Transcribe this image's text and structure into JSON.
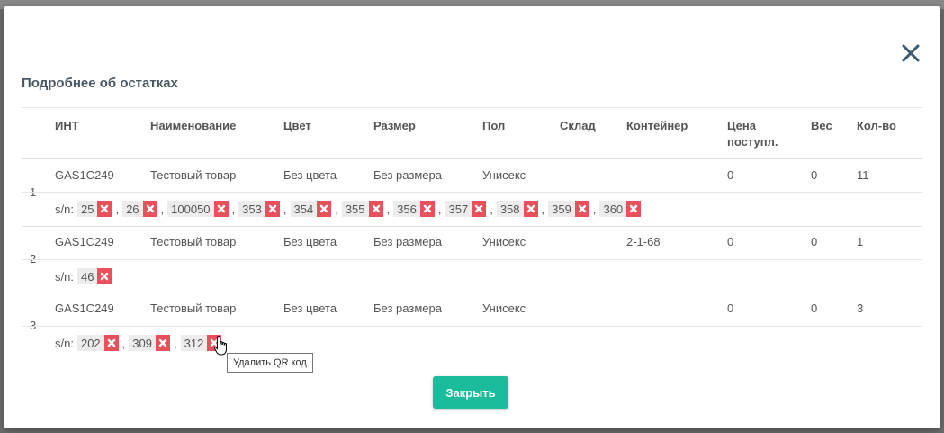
{
  "modal": {
    "title": "Подробнее об остатках",
    "close_button": "Закрыть"
  },
  "columns": {
    "int": "ИНТ",
    "name": "Наименование",
    "color": "Цвет",
    "size": "Размер",
    "gender": "Пол",
    "warehouse": "Склад",
    "container": "Контейнер",
    "price": "Цена поступл.",
    "weight": "Вес",
    "qty": "Кол-во"
  },
  "serial_label": "s/n:",
  "rows": [
    {
      "num": "1",
      "int": "GAS1C249",
      "name": "Тестовый товар",
      "color": "Без цвета",
      "size": "Без размера",
      "gender": "Унисекс",
      "warehouse": "",
      "container": "",
      "price": "0",
      "weight": "0",
      "qty": "11",
      "serials": [
        "25",
        "26",
        "100050",
        "353",
        "354",
        "355",
        "356",
        "357",
        "358",
        "359",
        "360"
      ]
    },
    {
      "num": "2",
      "int": "GAS1C249",
      "name": "Тестовый товар",
      "color": "Без цвета",
      "size": "Без размера",
      "gender": "Унисекс",
      "warehouse": "",
      "container": "2-1-68",
      "price": "0",
      "weight": "0",
      "qty": "1",
      "serials": [
        "46"
      ]
    },
    {
      "num": "3",
      "int": "GAS1C249",
      "name": "Тестовый товар",
      "color": "Без цвета",
      "size": "Без размера",
      "gender": "Унисекс",
      "warehouse": "",
      "container": "",
      "price": "0",
      "weight": "0",
      "qty": "3",
      "serials": [
        "202",
        "309",
        "312"
      ]
    }
  ],
  "tooltip": "Удалить QR код",
  "icons": {
    "close": "close-icon",
    "delete": "delete-x-icon",
    "cursor": "hand-pointer-icon"
  },
  "colors": {
    "accent": "#1abc9c",
    "danger": "#e8505b",
    "title": "#4a5866",
    "close_icon": "#3d5a73"
  }
}
